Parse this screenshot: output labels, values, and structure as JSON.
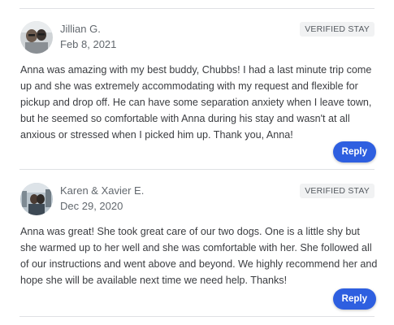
{
  "reviews": [
    {
      "name": "Jillian G.",
      "date": "Feb 8, 2021",
      "badge": "VERIFIED STAY",
      "text": "Anna was amazing with my best buddy, Chubbs! I had a last minute trip come up and she was extremely accommodating with my request and flexible for pickup and drop off. He can have some separation anxiety when I leave town, but he seemed so comfortable with Anna during his stay and wasn't at all anxious or stressed when I picked him up. Thank you, Anna!",
      "reply_label": "Reply"
    },
    {
      "name": "Karen & Xavier E.",
      "date": "Dec 29, 2020",
      "badge": "VERIFIED STAY",
      "text": "Anna was great! She took great care of our two dogs. One is a little shy but she warmed up to her well and she was comfortable with her. She followed all of our instructions and went above and beyond. We highly recommend her and hope she will be available next time we need help. Thanks!",
      "reply_label": "Reply"
    }
  ],
  "colors": {
    "reply_button": "#2e5fe0",
    "badge_bg": "#f1f2f3",
    "divider": "#dfe1e4"
  }
}
